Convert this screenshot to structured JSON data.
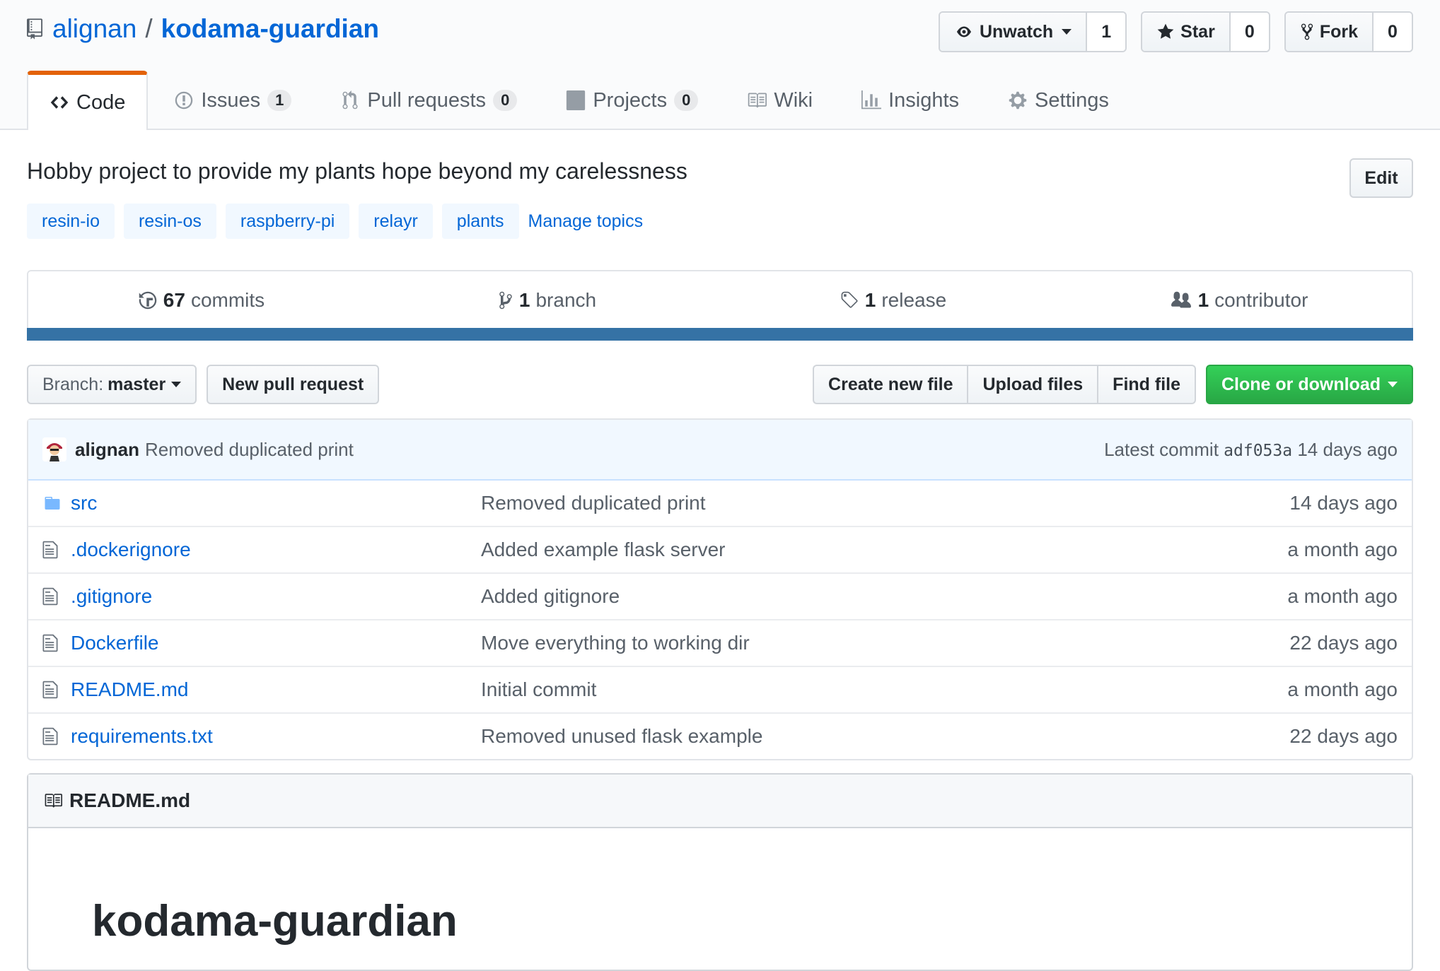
{
  "repo": {
    "owner": "alignan",
    "separator": "/",
    "name": "kodama-guardian"
  },
  "actions": {
    "watch": {
      "label": "Unwatch",
      "count": "1"
    },
    "star": {
      "label": "Star",
      "count": "0"
    },
    "fork": {
      "label": "Fork",
      "count": "0"
    }
  },
  "tabs": [
    {
      "label": "Code",
      "icon": "code-icon"
    },
    {
      "label": "Issues",
      "icon": "issue-icon",
      "count": "1"
    },
    {
      "label": "Pull requests",
      "icon": "pull-request-icon",
      "count": "0"
    },
    {
      "label": "Projects",
      "icon": "project-icon",
      "count": "0"
    },
    {
      "label": "Wiki",
      "icon": "book-icon"
    },
    {
      "label": "Insights",
      "icon": "graph-icon"
    },
    {
      "label": "Settings",
      "icon": "gear-icon"
    }
  ],
  "description": "Hobby project to provide my plants hope beyond my carelessness",
  "edit_label": "Edit",
  "topics": [
    "resin-io",
    "resin-os",
    "raspberry-pi",
    "relayr",
    "plants"
  ],
  "manage_topics": "Manage topics",
  "summary": {
    "commits": {
      "num": "67",
      "label": "commits"
    },
    "branches": {
      "num": "1",
      "label": "branch"
    },
    "releases": {
      "num": "1",
      "label": "release"
    },
    "contributors": {
      "num": "1",
      "label": "contributor"
    },
    "language_color": "#3572A5"
  },
  "file_nav": {
    "branch_label": "Branch:",
    "branch_value": "master",
    "new_pr": "New pull request",
    "create_file": "Create new file",
    "upload_files": "Upload files",
    "find_file": "Find file",
    "clone": "Clone or download"
  },
  "latest_commit": {
    "author": "alignan",
    "message": "Removed duplicated print",
    "prefix": "Latest commit",
    "sha": "adf053a",
    "age": "14 days ago"
  },
  "files": [
    {
      "name": "src",
      "type": "folder",
      "message": "Removed duplicated print",
      "age": "14 days ago"
    },
    {
      "name": ".dockerignore",
      "type": "file",
      "message": "Added example flask server",
      "age": "a month ago"
    },
    {
      "name": ".gitignore",
      "type": "file",
      "message": "Added gitignore",
      "age": "a month ago"
    },
    {
      "name": "Dockerfile",
      "type": "file",
      "message": "Move everything to working dir",
      "age": "22 days ago"
    },
    {
      "name": "README.md",
      "type": "file",
      "message": "Initial commit",
      "age": "a month ago"
    },
    {
      "name": "requirements.txt",
      "type": "file",
      "message": "Removed unused flask example",
      "age": "22 days ago"
    }
  ],
  "readme": {
    "filename": "README.md",
    "heading": "kodama-guardian"
  }
}
